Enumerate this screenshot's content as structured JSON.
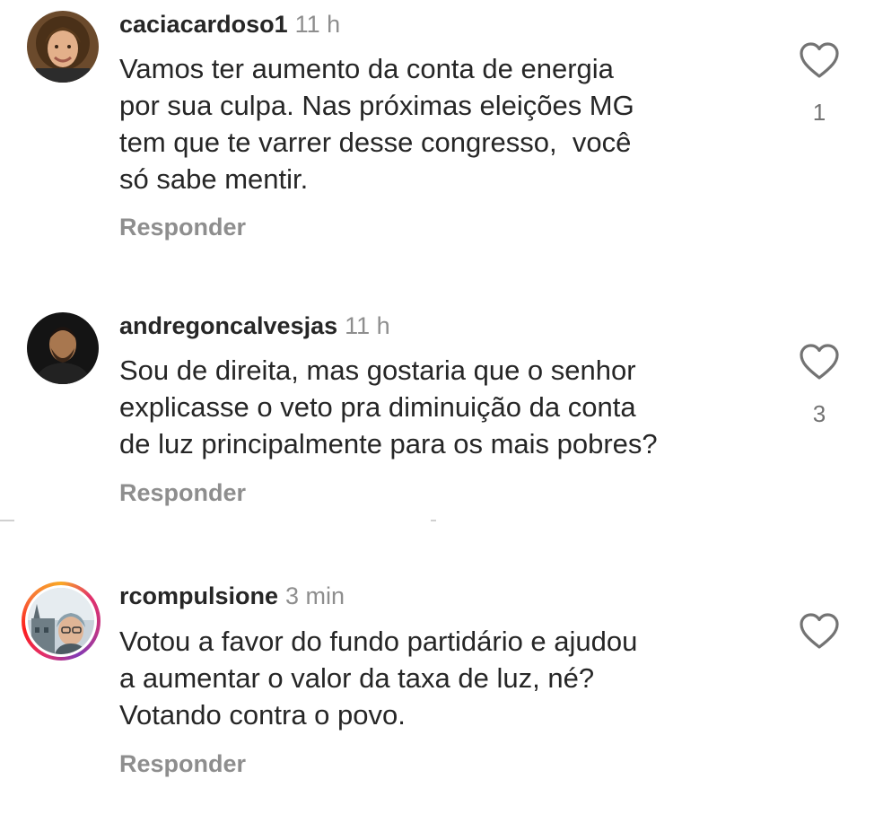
{
  "comments": [
    {
      "username": "caciacardoso1",
      "time": "11 h",
      "lines": [
        "Vamos ter aumento da conta de energia",
        "por sua culpa. Nas próximas eleições MG",
        "tem que te varrer desse congresso,  você",
        "só sabe mentir."
      ],
      "reply_label": "Responder",
      "likes": "1",
      "avatar_icon": "profile-photo-woman"
    },
    {
      "username": "andregoncalvesjas",
      "time": "11 h",
      "lines": [
        "Sou de direita, mas gostaria que o senhor",
        "explicasse o veto pra diminuição da conta",
        "de luz principalmente para os mais pobres?"
      ],
      "reply_label": "Responder",
      "likes": "3",
      "avatar_icon": "profile-photo-man"
    },
    {
      "username": "rcompulsione",
      "time": "3 min",
      "lines": [
        "Votou a favor do fundo partidário e ajudou",
        "a aumentar o valor da taxa de luz, né?",
        "Votando contra o povo."
      ],
      "reply_label": "Responder",
      "likes": "",
      "avatar_icon": "profile-photo-story-ring"
    }
  ],
  "colors": {
    "username": "#262626",
    "secondary": "#8e8e8e",
    "text": "#262626"
  },
  "icons": {
    "like": "heart-outline-icon"
  }
}
